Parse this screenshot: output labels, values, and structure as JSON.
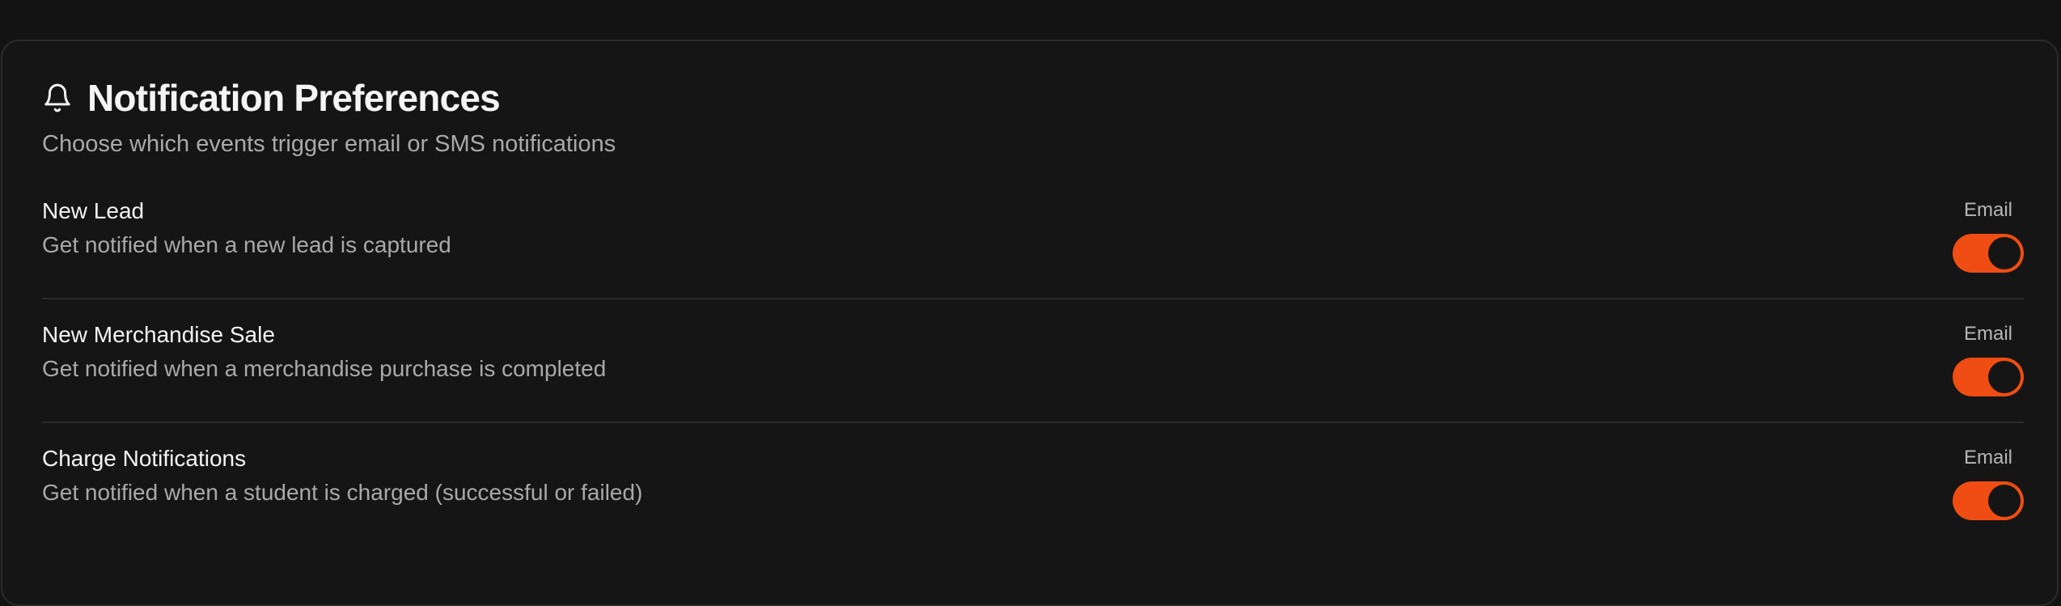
{
  "header": {
    "icon": "bell-icon",
    "title": "Notification Preferences",
    "subtitle": "Choose which events trigger email or SMS notifications"
  },
  "accent_color": "#ef4d13",
  "events": [
    {
      "title": "New Lead",
      "description": "Get notified when a new lead is captured",
      "channel_label": "Email",
      "enabled": true
    },
    {
      "title": "New Merchandise Sale",
      "description": "Get notified when a merchandise purchase is completed",
      "channel_label": "Email",
      "enabled": true
    },
    {
      "title": "Charge Notifications",
      "description": "Get notified when a student is charged (successful or failed)",
      "channel_label": "Email",
      "enabled": true
    }
  ]
}
